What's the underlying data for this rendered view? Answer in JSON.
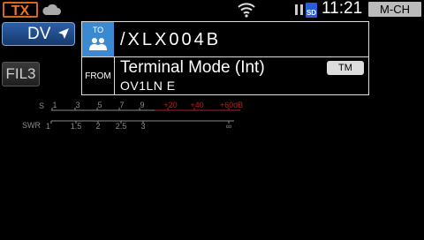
{
  "status_bar": {
    "tx": "TX",
    "clock": "11:21",
    "mode": "M-CH",
    "sd": "SD",
    "icons": [
      "cloud-icon",
      "wifi-icon",
      "pause-icon",
      "sd-card-icon"
    ]
  },
  "mode_button": {
    "label": "DV"
  },
  "filter_button": {
    "label": "FIL3"
  },
  "call_panel": {
    "to_label": "TO",
    "to_value": "/XLX004B",
    "from_label": "FROM",
    "from_name": "Terminal Mode (Int)",
    "from_call": "OV1LN  E",
    "from_badge": "TM"
  },
  "meter": {
    "s_label": "S",
    "s_ticks": [
      "1",
      "3",
      "5",
      "7",
      "9",
      "+20",
      "+40",
      "+60dB"
    ],
    "swr_label": "SWR",
    "swr_ticks": [
      "1",
      "1.5",
      "2",
      "2.5",
      "3",
      "∞"
    ]
  },
  "colors": {
    "tx": "#e8742a",
    "to_cell": "#3b8ad1",
    "dv_button": "#2b5fa8",
    "meter_red": "#b02020",
    "meter_gray": "#8a8a8a"
  }
}
